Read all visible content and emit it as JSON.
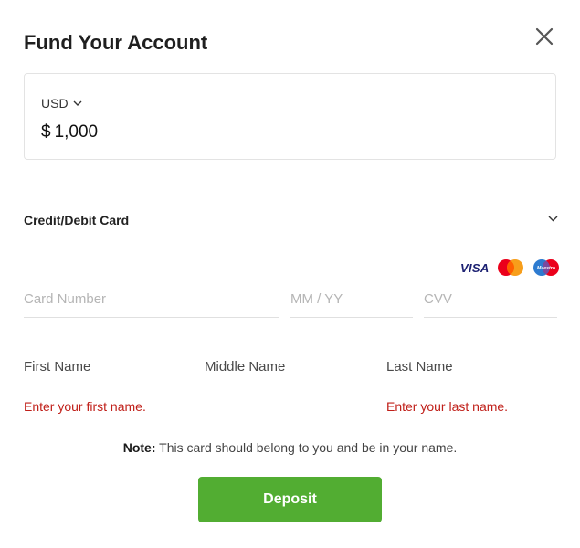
{
  "dialog": {
    "title": "Fund Your Account"
  },
  "amount": {
    "currency": "USD",
    "symbol": "$",
    "value": "1,000"
  },
  "payment_method": {
    "label": "Credit/Debit Card"
  },
  "card_brands": {
    "visa": "VISA",
    "mastercard": "mastercard-icon",
    "maestro": "Maestro"
  },
  "fields": {
    "card_number": {
      "placeholder": "Card Number",
      "value": ""
    },
    "expiry": {
      "placeholder": "MM / YY",
      "value": ""
    },
    "cvv": {
      "placeholder": "CVV",
      "value": ""
    },
    "first_name": {
      "placeholder": "First Name",
      "value": "",
      "error": "Enter your first name."
    },
    "middle_name": {
      "placeholder": "Middle Name",
      "value": ""
    },
    "last_name": {
      "placeholder": "Last Name",
      "value": "",
      "error": "Enter your last name."
    }
  },
  "note": {
    "label": "Note:",
    "text": "This card should belong to you and be in your name."
  },
  "actions": {
    "deposit_label": "Deposit"
  },
  "colors": {
    "accent_green": "#52ad32",
    "error_red": "#c0201a",
    "visa_blue": "#1a1f71",
    "mastercard_red": "#eb001b",
    "mastercard_orange": "#f79e1b",
    "maestro_blue": "#2d7bd0"
  }
}
